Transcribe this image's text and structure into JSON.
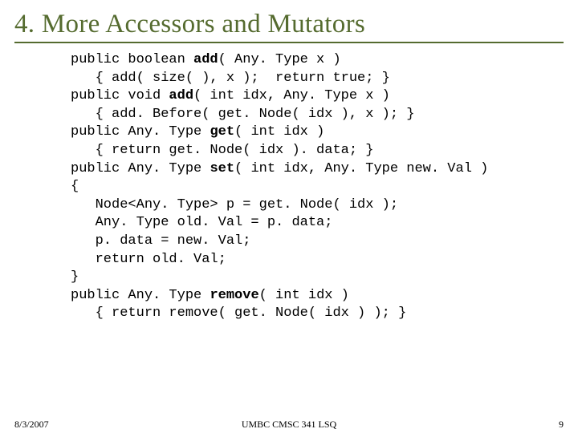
{
  "title": "4. More Accessors and Mutators",
  "code": {
    "l1a": "public boolean ",
    "l1b": "add",
    "l1c": "( Any. Type x )",
    "l2": "   { add( size( ), x );  return true; }",
    "l3a": "public void ",
    "l3b": "add",
    "l3c": "( int idx, Any. Type x )",
    "l4": "   { add. Before( get. Node( idx ), x ); }",
    "l5a": "public Any. Type ",
    "l5b": "get",
    "l5c": "( int idx )",
    "l6": "   { return get. Node( idx ). data; }",
    "l7a": "public Any. Type ",
    "l7b": "set",
    "l7c": "( int idx, Any. Type new. Val )",
    "l8": "{",
    "l9": "   Node<Any. Type> p = get. Node( idx );",
    "l10": "   Any. Type old. Val = p. data;",
    "l11": "   p. data = new. Val;",
    "l12": "   return old. Val;",
    "l13": "}",
    "l14a": "public Any. Type ",
    "l14b": "remove",
    "l14c": "( int idx )",
    "l15": "   { return remove( get. Node( idx ) ); }"
  },
  "footer": {
    "date": "8/3/2007",
    "center": "UMBC CMSC 341 LSQ",
    "page": "9"
  }
}
